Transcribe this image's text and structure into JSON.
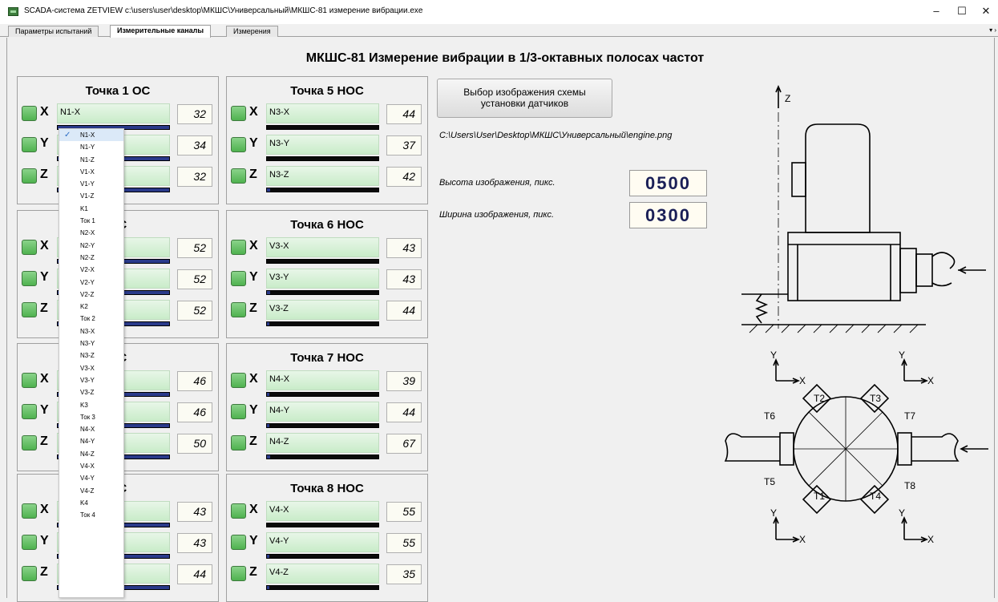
{
  "window": {
    "title": "SCADA-система ZETVIEW c:\\users\\user\\desktop\\МКШС\\Универсальный\\МКШС-81 измерение вибрации.exe",
    "minimize": "–",
    "maximize": "☐",
    "close": "✕"
  },
  "tabs": [
    {
      "label": "Параметры испытаний"
    },
    {
      "label": "Измерительные каналы"
    },
    {
      "label": "Измерения"
    }
  ],
  "tab_overflow": "▾ ›",
  "page_title": "МКШС-81 Измерение вибрации в 1/3-октавных полосах частот",
  "panels_left": [
    {
      "title": "Точка 1 ОС",
      "rows": [
        {
          "axis": "X",
          "channel": "N1-X",
          "value": "32",
          "level": 1.0
        },
        {
          "axis": "Y",
          "channel": "",
          "value": "34",
          "level": 1.0
        },
        {
          "axis": "Z",
          "channel": "",
          "value": "32",
          "level": 1.0
        }
      ]
    },
    {
      "title": "ОС",
      "rows": [
        {
          "axis": "X",
          "channel": "",
          "value": "52",
          "level": 1.0
        },
        {
          "axis": "Y",
          "channel": "",
          "value": "52",
          "level": 1.0
        },
        {
          "axis": "Z",
          "channel": "",
          "value": "52",
          "level": 1.0
        }
      ]
    },
    {
      "title": "ОС",
      "rows": [
        {
          "axis": "X",
          "channel": "",
          "value": "46",
          "level": 1.0
        },
        {
          "axis": "Y",
          "channel": "",
          "value": "46",
          "level": 1.0
        },
        {
          "axis": "Z",
          "channel": "",
          "value": "50",
          "level": 1.0
        }
      ]
    },
    {
      "title": "ОС",
      "rows": [
        {
          "axis": "X",
          "channel": "",
          "value": "43",
          "level": 1.0
        },
        {
          "axis": "Y",
          "channel": "",
          "value": "43",
          "level": 1.0
        },
        {
          "axis": "Z",
          "channel": "",
          "value": "44",
          "level": 1.0
        }
      ]
    }
  ],
  "panels_right": [
    {
      "title": "Точка 5 НОС",
      "rows": [
        {
          "axis": "X",
          "channel": "N3-X",
          "value": "44",
          "level": 0.0
        },
        {
          "axis": "Y",
          "channel": "N3-Y",
          "value": "37",
          "level": 0.0
        },
        {
          "axis": "Z",
          "channel": "N3-Z",
          "value": "42",
          "level": 0.03
        }
      ]
    },
    {
      "title": "Точка 6 НОС",
      "rows": [
        {
          "axis": "X",
          "channel": "V3-X",
          "value": "43",
          "level": 0.0
        },
        {
          "axis": "Y",
          "channel": "V3-Y",
          "value": "43",
          "level": 0.03
        },
        {
          "axis": "Z",
          "channel": "V3-Z",
          "value": "44",
          "level": 0.02
        }
      ]
    },
    {
      "title": "Точка 7 НОС",
      "rows": [
        {
          "axis": "X",
          "channel": "N4-X",
          "value": "39",
          "level": 0.02
        },
        {
          "axis": "Y",
          "channel": "N4-Y",
          "value": "44",
          "level": 0.02
        },
        {
          "axis": "Z",
          "channel": "N4-Z",
          "value": "67",
          "level": 0.03
        }
      ]
    },
    {
      "title": "Точка 8 НОС",
      "rows": [
        {
          "axis": "X",
          "channel": "V4-X",
          "value": "55",
          "level": 0.0
        },
        {
          "axis": "Y",
          "channel": "V4-Y",
          "value": "55",
          "level": 0.02
        },
        {
          "axis": "Z",
          "channel": "V4-Z",
          "value": "35",
          "level": 0.02
        }
      ]
    }
  ],
  "image_settings": {
    "select_button": "Выбор изображения схемы установки датчиков",
    "path": "C:\\Users\\User\\Desktop\\МКШС\\Универсальный\\engine.png",
    "height_label": "Высота изображения, пикс.",
    "height_value": "0500",
    "width_label": "Ширина изображения, пикс.",
    "width_value": "0300"
  },
  "dropdown": {
    "selected": "N1-X",
    "options": [
      "N1-X",
      "N1-Y",
      "N1-Z",
      "V1-X",
      "V1-Y",
      "V1-Z",
      "K1",
      "Ток 1",
      "N2-X",
      "N2-Y",
      "N2-Z",
      "V2-X",
      "V2-Y",
      "V2-Z",
      "K2",
      "Ток 2",
      "N3-X",
      "N3-Y",
      "N3-Z",
      "V3-X",
      "V3-Y",
      "V3-Z",
      "K3",
      "Ток 3",
      "N4-X",
      "N4-Y",
      "N4-Z",
      "V4-X",
      "V4-Y",
      "V4-Z",
      "K4",
      "Ток 4"
    ]
  },
  "diagram": {
    "z_label": "Z",
    "x_label": "X",
    "y_label": "Y",
    "sensors": [
      "T1",
      "T2",
      "T3",
      "T4",
      "T5",
      "T6",
      "T7",
      "T8"
    ]
  },
  "colors": {
    "led": "#4fb24f",
    "value_text": "#1a1f57",
    "bar_fill": "#2a3a8a"
  }
}
